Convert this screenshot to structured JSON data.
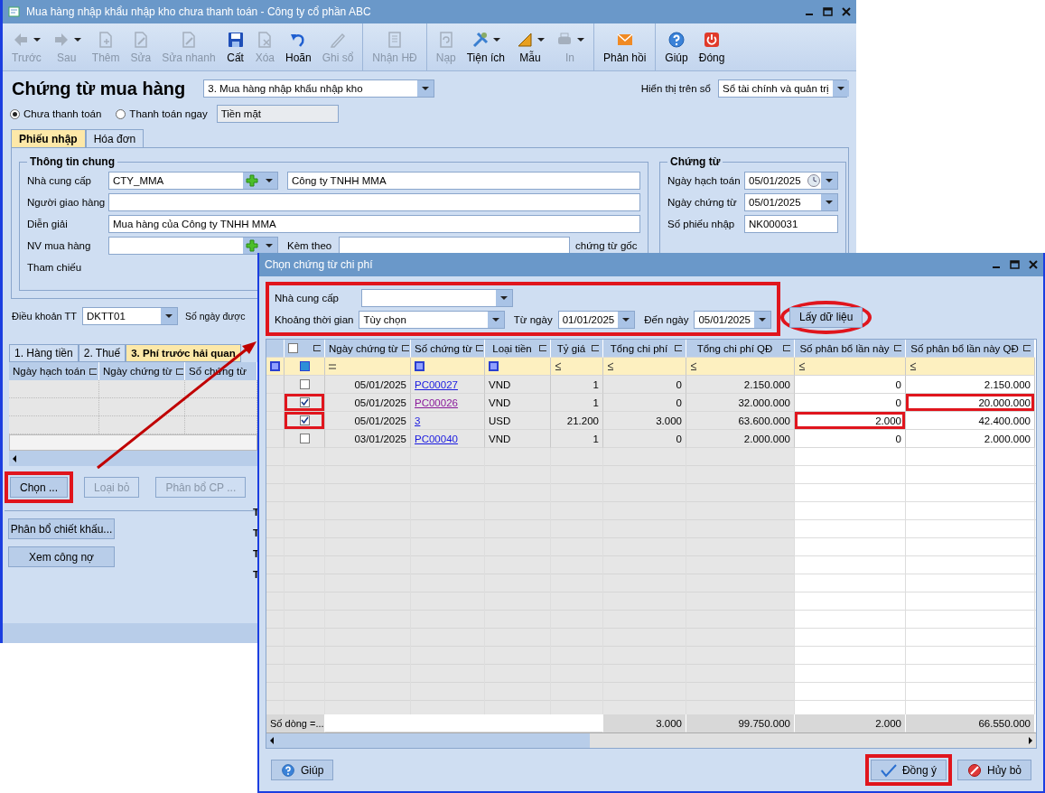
{
  "main_window": {
    "title": "Mua hàng nhập khẩu nhập kho chưa thanh toán - Công ty cổ phần ABC"
  },
  "toolbar": [
    {
      "label": "Trước",
      "disabled": true,
      "dropdown": true,
      "separator_before": false
    },
    {
      "label": "Sau",
      "disabled": true,
      "dropdown": true,
      "separator_before": false
    },
    {
      "label": "Thêm",
      "disabled": true,
      "dropdown": false,
      "separator_before": false
    },
    {
      "label": "Sửa",
      "disabled": true,
      "dropdown": false,
      "separator_before": false
    },
    {
      "label": "Sửa nhanh",
      "disabled": true,
      "dropdown": false,
      "separator_before": false
    },
    {
      "label": "Cất",
      "disabled": false,
      "dropdown": false,
      "separator_before": false
    },
    {
      "label": "Xóa",
      "disabled": true,
      "dropdown": false,
      "separator_before": false
    },
    {
      "label": "Hoãn",
      "disabled": false,
      "dropdown": false,
      "separator_before": false
    },
    {
      "label": "Ghi sổ",
      "disabled": true,
      "dropdown": false,
      "separator_before": false
    },
    {
      "label": "Nhận HĐ",
      "disabled": true,
      "dropdown": false,
      "separator_before": true
    },
    {
      "label": "Nạp",
      "disabled": true,
      "dropdown": false,
      "separator_before": true
    },
    {
      "label": "Tiện ích",
      "disabled": false,
      "dropdown": true,
      "separator_before": false
    },
    {
      "label": "Mẫu",
      "disabled": false,
      "dropdown": true,
      "separator_before": false
    },
    {
      "label": "In",
      "disabled": true,
      "dropdown": true,
      "separator_before": false
    },
    {
      "label": "Phản hồi",
      "disabled": false,
      "dropdown": false,
      "separator_before": true
    },
    {
      "label": "Giúp",
      "disabled": false,
      "dropdown": false,
      "separator_before": true
    },
    {
      "label": "Đóng",
      "disabled": false,
      "dropdown": false,
      "separator_before": false
    }
  ],
  "voucher": {
    "heading": "Chứng từ mua hàng",
    "type": "3. Mua hàng nhập khẩu nhập kho",
    "display_label": "Hiển thị trên sổ",
    "display_value": "Sổ tài chính và quản trị"
  },
  "payment_options": [
    {
      "label": "Chưa thanh toán",
      "selected": true
    },
    {
      "label": "Thanh toán ngay",
      "selected": false
    }
  ],
  "payment_method": "Tiền mặt",
  "form_tabs": [
    {
      "label": "Phiếu nhập",
      "selected": true
    },
    {
      "label": "Hóa đơn",
      "selected": false
    }
  ],
  "general_info": {
    "title": "Thông tin chung",
    "fields": [
      {
        "label": "Nhà cung cấp",
        "kind": "lookup",
        "value": "CTY_MMA",
        "name_value": "Công ty TNHH MMA"
      },
      {
        "label": "Người giao hàng",
        "kind": "text"
      },
      {
        "label": "Diễn giải",
        "kind": "text",
        "value": "Mua hàng của Công ty TNHH MMA"
      },
      {
        "label": "NV mua hàng",
        "kind": "lookup_attach",
        "attach_label": "Kèm theo",
        "attach_suffix": "chứng từ gốc"
      },
      {
        "label": "Tham chiếu",
        "kind": "plain"
      }
    ]
  },
  "voucher_info": {
    "title": "Chứng từ",
    "fields": [
      {
        "label": "Ngày hạch toán",
        "kind": "date_clock",
        "value": "05/01/2025"
      },
      {
        "label": "Ngày chứng từ",
        "kind": "date",
        "value": "05/01/2025"
      },
      {
        "label": "Số phiếu nhập",
        "kind": "text",
        "value": "NK000031"
      }
    ]
  },
  "payment_terms": {
    "label": "Điều khoản TT",
    "value": "DKTT01",
    "days_label": "Số ngày được"
  },
  "detail_tabs": [
    {
      "label": "1. Hàng tiền",
      "selected": false
    },
    {
      "label": "2. Thuế",
      "selected": false
    },
    {
      "label": "3. Phí trước hải quan",
      "selected": true
    }
  ],
  "detail_columns": [
    "Ngày hạch toán",
    "Ngày chứng từ",
    "Số chứng từ"
  ],
  "detail_buttons": [
    {
      "label": "Chọn ...",
      "disabled": false,
      "highlighted": true
    },
    {
      "label": "Loại bỏ",
      "disabled": true,
      "highlighted": false
    },
    {
      "label": "Phân bổ CP ...",
      "disabled": true,
      "highlighted": false
    }
  ],
  "side_buttons": [
    "Phân bổ chiết khấu...",
    "Xem công nợ"
  ],
  "total_labels": [
    "T",
    "T",
    "T",
    "T"
  ],
  "dialog": {
    "title": "Chọn chứng từ chi phí",
    "filter_highlighted": true,
    "supplier_label": "Nhà cung cấp",
    "period_label": "Khoảng thời gian",
    "period_value": "Tùy chọn",
    "from_label": "Từ ngày",
    "from_value": "01/01/2025",
    "to_label": "Đến ngày",
    "to_value": "05/01/2025",
    "fetch": {
      "label": "Lấy dữ liệu",
      "highlighted": true
    }
  },
  "grid": {
    "header_checked": false,
    "columns": [
      "Ngày chứng từ",
      "Số chứng từ",
      "Loại tiền",
      "Tỷ giá",
      "Tổng chi phí",
      "Tổng chi phí QĐ",
      "Số phân bổ lần này",
      "Số phân bổ lần này QĐ"
    ],
    "rows": [
      {
        "checked": false,
        "check_highlighted": false,
        "date": "05/01/2025",
        "number": "PC00027",
        "visited": false,
        "currency": "VND",
        "rate": "1",
        "cost": "0",
        "cost_converted": "2.150.000",
        "allocation": "0",
        "allocation_highlighted": false,
        "allocation_converted": "2.150.000",
        "converted_highlighted": false
      },
      {
        "checked": true,
        "check_highlighted": true,
        "date": "05/01/2025",
        "number": "PC00026",
        "visited": true,
        "currency": "VND",
        "rate": "1",
        "cost": "0",
        "cost_converted": "32.000.000",
        "allocation": "0",
        "allocation_highlighted": false,
        "allocation_converted": "20.000.000",
        "converted_highlighted": true
      },
      {
        "checked": true,
        "check_highlighted": true,
        "date": "05/01/2025",
        "number": "3",
        "visited": false,
        "currency": "USD",
        "rate": "21.200",
        "cost": "3.000",
        "cost_converted": "63.600.000",
        "allocation": "2.000",
        "allocation_highlighted": true,
        "allocation_converted": "42.400.000",
        "converted_highlighted": false
      },
      {
        "checked": false,
        "check_highlighted": false,
        "date": "03/01/2025",
        "number": "PC00040",
        "visited": false,
        "currency": "VND",
        "rate": "1",
        "cost": "0",
        "cost_converted": "2.000.000",
        "allocation": "0",
        "allocation_highlighted": false,
        "allocation_converted": "2.000.000",
        "converted_highlighted": false
      }
    ],
    "footer": {
      "label": "Số dòng =...",
      "cost": "3.000",
      "cost_converted": "99.750.000",
      "allocation": "2.000",
      "allocation_converted": "66.550.000"
    }
  },
  "dialog_buttons": [
    {
      "label": "Giúp",
      "kind": "help",
      "highlighted": false
    },
    {
      "label": "Đồng ý",
      "kind": "ok",
      "highlighted": true
    },
    {
      "label": "Hủy bỏ",
      "kind": "cancel",
      "highlighted": false
    }
  ]
}
